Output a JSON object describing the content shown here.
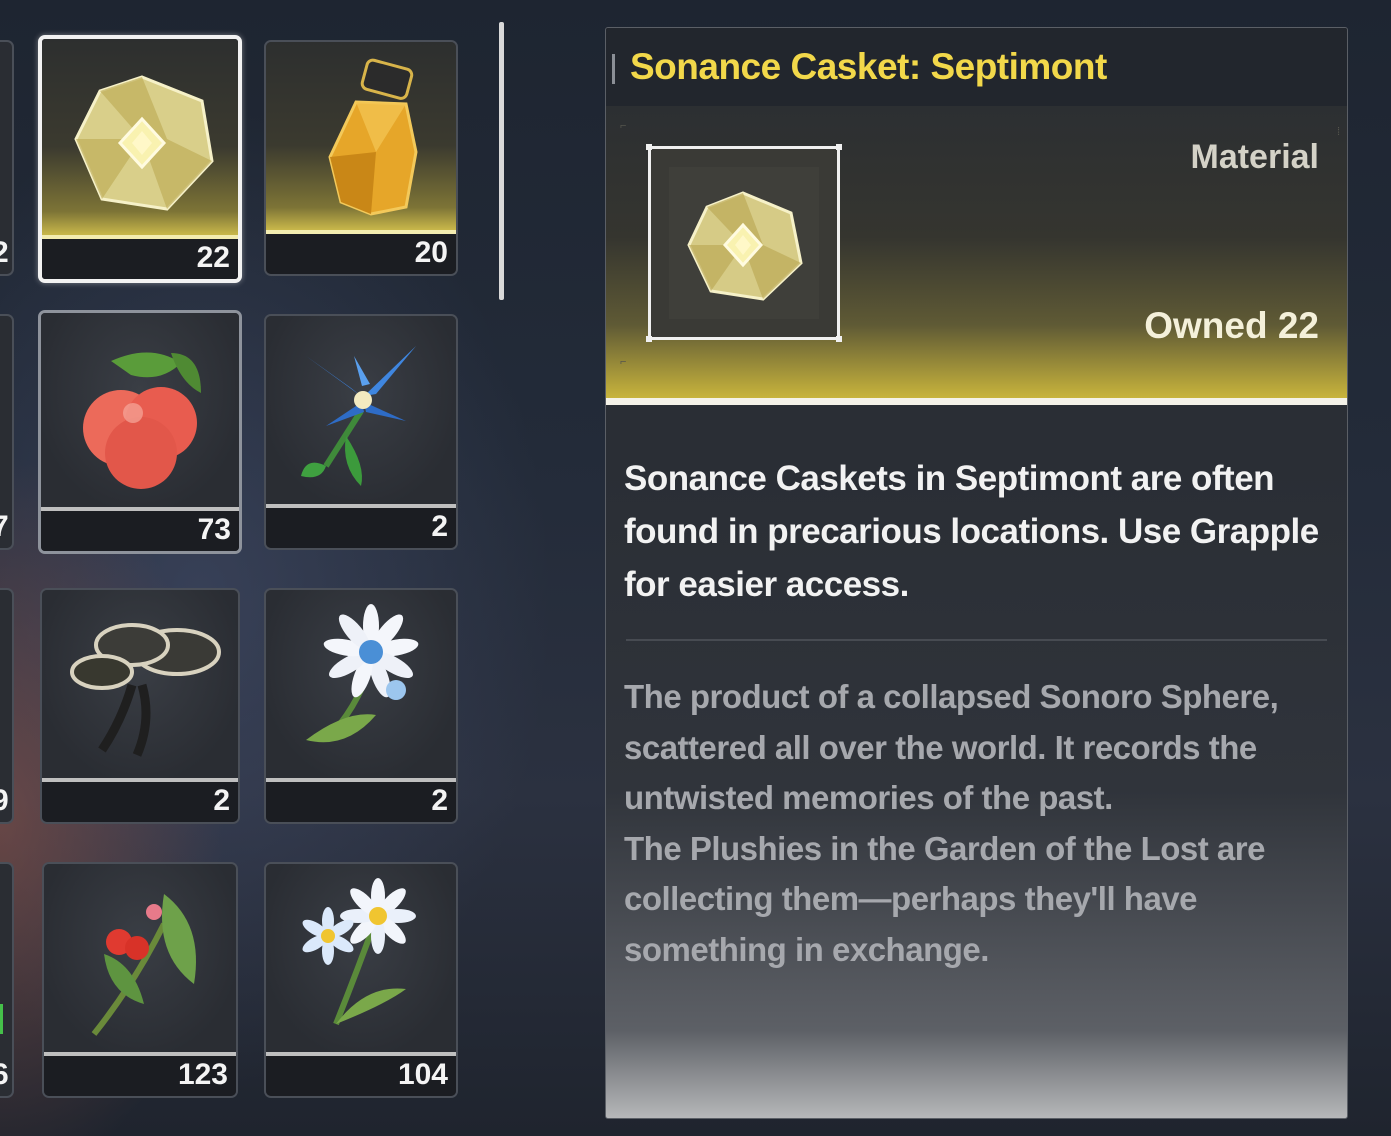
{
  "inventory": {
    "left_edge_counts": [
      "2",
      "7",
      "9",
      "6"
    ],
    "items": [
      {
        "name": "Sonance Casket: Septimont",
        "count": "22",
        "icon": "sonance-casket-icon",
        "selected": true
      },
      {
        "name": "Golden liquid bottle",
        "count": "20",
        "icon": "potion-bottle-icon"
      },
      {
        "name": "Red berry fruit",
        "count": "73",
        "icon": "red-berry-icon",
        "hovered": true
      },
      {
        "name": "Blue iris flower",
        "count": "2",
        "icon": "blue-iris-icon"
      },
      {
        "name": "Dark fungus",
        "count": "2",
        "icon": "fungus-icon"
      },
      {
        "name": "White daisy",
        "count": "2",
        "icon": "daisy-icon"
      },
      {
        "name": "Red berry sprig",
        "count": "123",
        "icon": "berry-sprig-icon"
      },
      {
        "name": "Blue wildflower",
        "count": "104",
        "icon": "wildflower-icon"
      }
    ]
  },
  "detail": {
    "title": "Sonance Casket: Septimont",
    "category": "Material",
    "owned": "Owned 22",
    "description": "Sonance Caskets in Septimont are often found in precarious locations. Use Grapple for easier access.",
    "lore": [
      "The product of a collapsed Sonoro Sphere, scattered all over the world. It records the untwisted memories of the past.",
      "The Plushies in the Garden of the Lost are collecting them—perhaps they'll have something in exchange."
    ]
  },
  "colors": {
    "title_gold": "#f2d84a",
    "selected_border": "#f2f2f2",
    "panel_bg": "#2a2e36"
  }
}
